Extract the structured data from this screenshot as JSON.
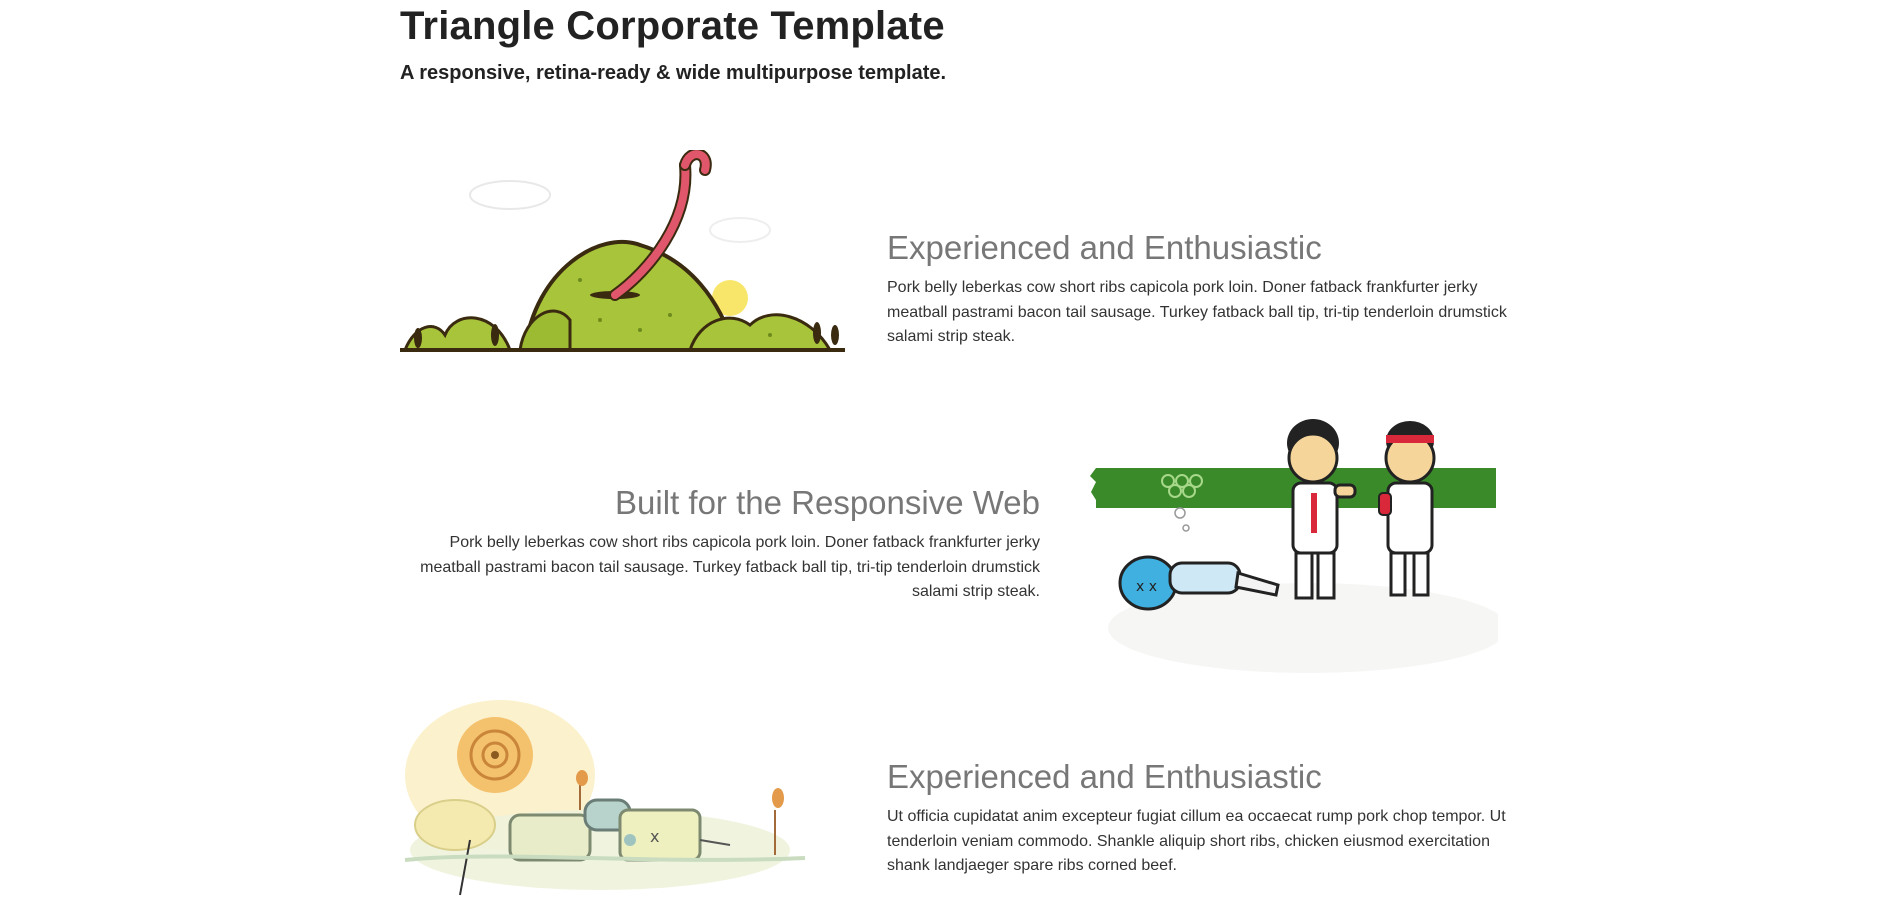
{
  "header": {
    "title": "Triangle Corporate Template",
    "subtitle": "A responsive, retina-ready & wide multipurpose template."
  },
  "features": [
    {
      "heading": "Experienced and Enthusiastic",
      "body": "Pork belly leberkas cow short ribs capicola pork loin. Doner fatback frankfurter jerky meatball pastrami bacon tail sausage. Turkey fatback ball tip, tri-tip tenderloin drumstick salami strip steak.",
      "image": "green-hills-worm-illustration"
    },
    {
      "heading": "Built for the Responsive Web",
      "body": "Pork belly leberkas cow short ribs capicola pork loin. Doner fatback frankfurter jerky meatball pastrami bacon tail sausage. Turkey fatback ball tip, tri-tip tenderloin drumstick salami strip steak.",
      "image": "karate-fighters-illustration"
    },
    {
      "heading": "Experienced and Enthusiastic",
      "body": "Ut officia cupidatat anim excepteur fugiat cillum ea occaecat rump pork chop tempor. Ut tenderloin veniam commodo. Shankle aliquip short ribs, chicken eiusmod exercitation shank landjaeger spare ribs corned beef.",
      "image": "sleeping-robot-illustration"
    }
  ],
  "colors": {
    "heading": "#777777",
    "text": "#333333",
    "title": "#222222",
    "hill_green": "#a8c43a",
    "banner_green": "#3a8a2a",
    "worm_pink": "#e0566a"
  }
}
